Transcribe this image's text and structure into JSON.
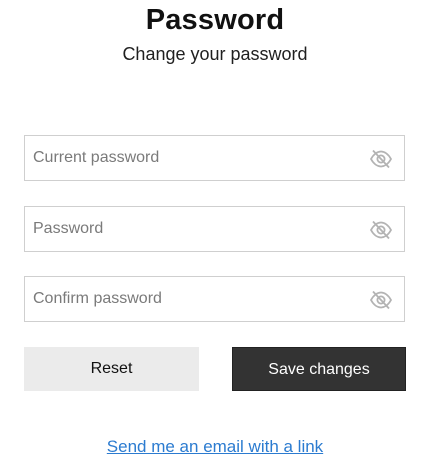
{
  "header": {
    "title": "Password",
    "subtitle": "Change your password"
  },
  "form": {
    "current_password": {
      "placeholder": "Current password",
      "value": "",
      "icon": "eye-slash-icon"
    },
    "new_password": {
      "placeholder": "Password",
      "value": "",
      "icon": "eye-slash-icon"
    },
    "confirm_password": {
      "placeholder": "Confirm password",
      "value": "",
      "icon": "eye-slash-icon"
    }
  },
  "actions": {
    "reset_label": "Reset",
    "save_label": "Save changes"
  },
  "footer": {
    "email_link": "Send me an email with a link"
  },
  "colors": {
    "save_button_bg": "#333333",
    "reset_button_bg": "#ebebeb",
    "link": "#2b7bd0",
    "field_border": "#cfcfcf"
  }
}
